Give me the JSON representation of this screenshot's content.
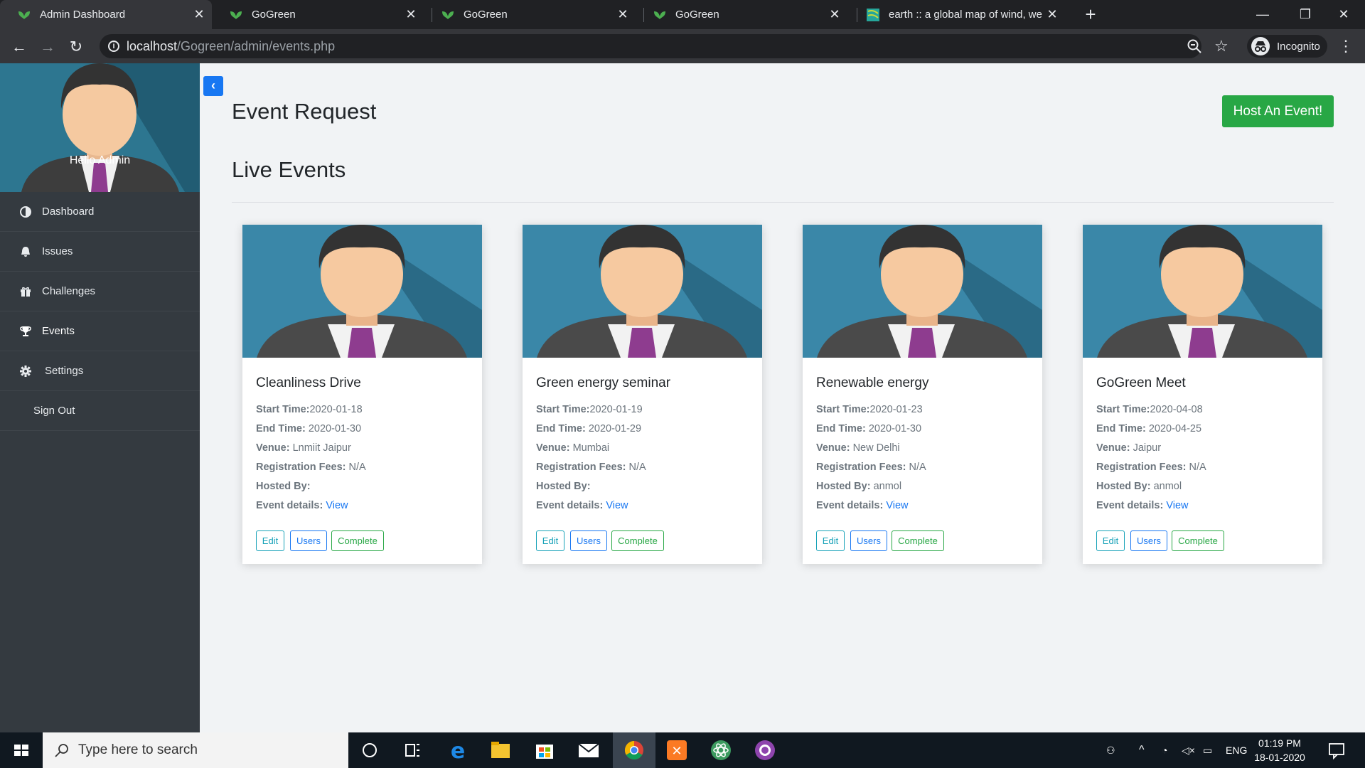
{
  "browser": {
    "tabs": [
      {
        "title": "Admin Dashboard",
        "active": true
      },
      {
        "title": "GoGreen",
        "active": false
      },
      {
        "title": "GoGreen",
        "active": false
      },
      {
        "title": "GoGreen",
        "active": false
      },
      {
        "title": "earth :: a global map of wind, we",
        "active": false
      }
    ],
    "url_host": "localhost",
    "url_path": "/Gogreen/admin/events.php",
    "incognito_label": "Incognito"
  },
  "sidebar": {
    "greeting": "Hello Admin",
    "items": [
      {
        "label": "Dashboard",
        "icon": "dashboard-icon"
      },
      {
        "label": "Issues",
        "icon": "bell-icon"
      },
      {
        "label": "Challenges",
        "icon": "gift-icon"
      },
      {
        "label": "Events",
        "icon": "trophy-icon",
        "active": true
      },
      {
        "label": "Settings",
        "icon": "gear-icon"
      },
      {
        "label": "Sign Out",
        "icon": ""
      }
    ]
  },
  "main": {
    "page_title": "Event Request",
    "host_button": "Host An Event!",
    "section_title": "Live Events",
    "labels": {
      "start": "Start Time:",
      "end": "End Time: ",
      "venue": "Venue: ",
      "fees": "Registration Fees: ",
      "hosted": "Hosted By: ",
      "details": "Event details: ",
      "view": "View",
      "edit": "Edit",
      "users": "Users",
      "complete": "Complete"
    },
    "events": [
      {
        "name": "Cleanliness Drive",
        "start": "2020-01-18",
        "end": "2020-01-30",
        "venue": "Lnmiit Jaipur",
        "fees": "N/A",
        "hosted_by": ""
      },
      {
        "name": "Green energy seminar",
        "start": "2020-01-19",
        "end": "2020-01-29",
        "venue": "Mumbai",
        "fees": "N/A",
        "hosted_by": ""
      },
      {
        "name": "Renewable energy",
        "start": "2020-01-23",
        "end": "2020-01-30",
        "venue": "New Delhi",
        "fees": "N/A",
        "hosted_by": "anmol"
      },
      {
        "name": "GoGreen Meet",
        "start": "2020-04-08",
        "end": "2020-04-25",
        "venue": "Jaipur",
        "fees": "N/A",
        "hosted_by": "anmol"
      }
    ]
  },
  "taskbar": {
    "search_placeholder": "Type here to search",
    "language": "ENG",
    "time": "01:19 PM",
    "date": "18-01-2020"
  },
  "colors": {
    "accent_blue": "#1877f2",
    "success_green": "#28a745",
    "sidebar_bg": "#343a40",
    "info_teal": "#17a2b8"
  }
}
